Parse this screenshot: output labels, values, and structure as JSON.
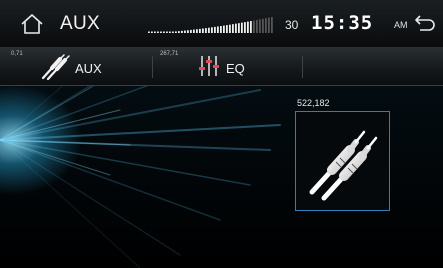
{
  "header": {
    "title": "AUX",
    "volume_value": "30",
    "volume_level": 0.85,
    "clock": "15:35",
    "ampm": "AM"
  },
  "tabs": [
    {
      "id": "aux",
      "small": "0,71",
      "label": "AUX",
      "icon": "rca-plug-icon"
    },
    {
      "id": "eq",
      "small": "267,71",
      "label": "EQ",
      "icon": "equalizer-icon"
    }
  ],
  "main": {
    "coord_label": "522,182",
    "tile_icon": "rca-cables-icon"
  },
  "colors": {
    "accent_border": "#2e7fb6",
    "glow": "#66d6ff",
    "eq_sliders": "#e14a5a"
  }
}
